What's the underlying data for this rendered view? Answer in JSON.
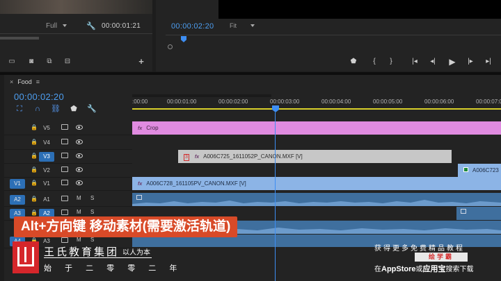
{
  "source_monitor": {
    "zoom": "Full",
    "timecode": "00:00:01:21"
  },
  "program_monitor": {
    "timecode": "00:00:02:20",
    "fit": "Fit"
  },
  "timeline": {
    "sequence_name": "Food",
    "timecode": "00:00:02:20",
    "ruler_labels": [
      ":00:00",
      "00:00:01:00",
      "00:00:02:00",
      "00:00:03:00",
      "00:00:04:00",
      "00:00:05:00",
      "00:00:06:00",
      "00:00:07:0"
    ],
    "video_tracks": [
      {
        "name": "V5",
        "source": "",
        "active": false
      },
      {
        "name": "V4",
        "source": "",
        "active": false
      },
      {
        "name": "V3",
        "source": "",
        "active": true
      },
      {
        "name": "V2",
        "source": "",
        "active": false
      },
      {
        "name": "V1",
        "source": "V1",
        "active": false
      }
    ],
    "audio_tracks": [
      {
        "name": "A1",
        "source": "A2",
        "m": "M",
        "s": "S"
      },
      {
        "name": "A2",
        "source": "A3",
        "m": "M",
        "s": "S"
      },
      {
        "name": "A3",
        "source": "A4",
        "m": "M",
        "s": "S"
      }
    ],
    "clips": {
      "v5": "Crop",
      "v3": "A006C725_1611052P_CANON.MXF [V]",
      "v3_badge": "3",
      "v2": "A006C723",
      "v1": "A006C728_161105PV_CANON.MXF [V]"
    },
    "fx_label": "fx"
  },
  "overlay": {
    "caption": "Alt+方向键 移动素材(需要激活轨道)",
    "org_name": "王氏教育集团",
    "org_slogan": "以人为本",
    "org_sub": "始 于 二 零 零 二 年",
    "promo_line1": "获得更多免费精品教程",
    "promo_badge": "绘学霸",
    "promo_line2_a": "在",
    "promo_line2_b": "AppStore",
    "promo_line2_c": "或",
    "promo_line2_d": "应用宝",
    "promo_line2_e": "搜索下载"
  },
  "colors": {
    "timecode_blue": "#4d9ef0",
    "crop_clip": "#e08be0",
    "video_clip": "#8cb4e6",
    "audio_clip": "#3f6f9e",
    "caption_bg": "#d84a28",
    "logo_red": "#d5262b"
  }
}
